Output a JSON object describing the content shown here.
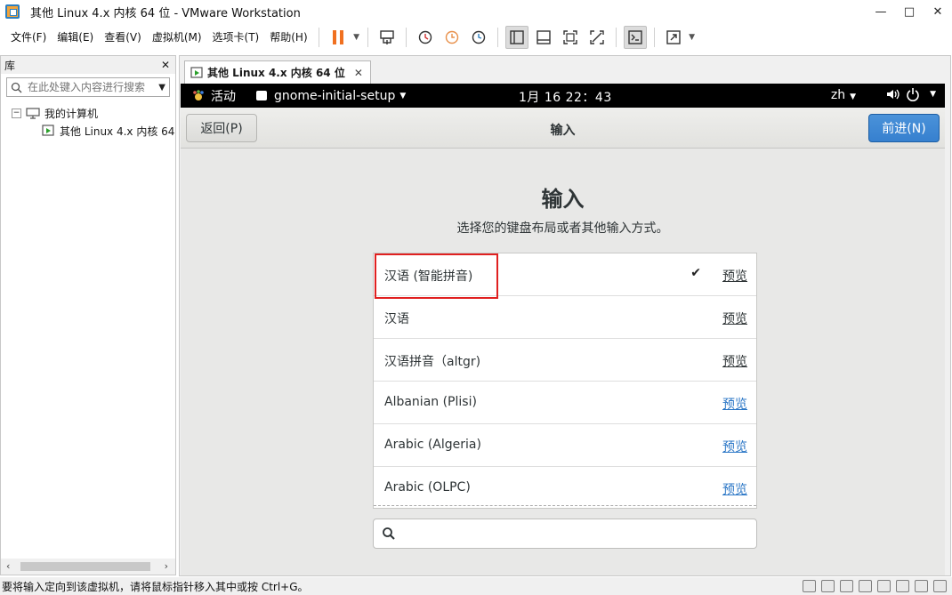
{
  "window": {
    "title": "其他 Linux 4.x 内核 64 位 - VMware Workstation",
    "minimize": "—",
    "maximize": "□",
    "close": "✕"
  },
  "menu": {
    "file": "文件(F)",
    "edit": "编辑(E)",
    "view": "查看(V)",
    "vm": "虚拟机(M)",
    "tabs": "选项卡(T)",
    "help": "帮助(H)"
  },
  "library": {
    "title": "库",
    "close": "✕",
    "search_placeholder": "在此处键入内容进行搜索",
    "tree": {
      "root": "我的计算机",
      "vm": "其他 Linux 4.x 内核 64"
    }
  },
  "vm_tab": {
    "label": "其他 Linux 4.x 内核 64 位",
    "close": "✕"
  },
  "gnome": {
    "activities": "活动",
    "app_menu": "gnome-initial-setup",
    "clock": "1月 16  22：43",
    "lang": "zh"
  },
  "setup": {
    "back": "返回(P)",
    "title": "输入",
    "next": "前进(N)",
    "heading": "输入",
    "subheading": "选择您的键盘布局或者其他输入方式。",
    "preview_label": "预览",
    "inputs": [
      {
        "name": "汉语 (智能拼音)",
        "selected": true
      },
      {
        "name": "汉语",
        "selected": false
      },
      {
        "name": "汉语拼音（altgr)",
        "selected": false
      },
      {
        "name": "Albanian (Plisi)",
        "selected": false
      },
      {
        "name": "Arabic (Algeria)",
        "selected": false
      },
      {
        "name": "Arabic (OLPC)",
        "selected": false
      }
    ],
    "search_value": ""
  },
  "status": {
    "message": "要将输入定向到该虚拟机，请将鼠标指针移入其中或按 Ctrl+G。"
  },
  "colors": {
    "accent_blue": "#3680cf",
    "highlight_red": "#e02020",
    "pause_orange": "#f07020"
  }
}
